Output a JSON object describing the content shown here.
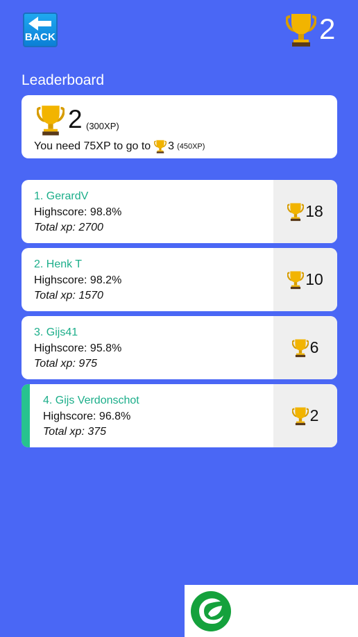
{
  "header": {
    "back_label": "BACK",
    "trophies": "2"
  },
  "section_title": "Leaderboard",
  "summary": {
    "level": "2",
    "xp": "(300XP)",
    "need_text": "You need 75XP to go to",
    "next_level": "3",
    "next_xp": "(450XP)"
  },
  "players": [
    {
      "name": "1. GerardV",
      "highscore": "Highscore: 98.8%",
      "total_xp": "Total xp: 2700",
      "trophies": "18"
    },
    {
      "name": "2. Henk T",
      "highscore": "Highscore: 98.2%",
      "total_xp": "Total xp: 1570",
      "trophies": "10"
    },
    {
      "name": "3. Gijs41",
      "highscore": "Highscore: 95.8%",
      "total_xp": "Total xp: 975",
      "trophies": "6"
    },
    {
      "name": "4. Gijs Verdonschot",
      "highscore": "Highscore: 96.8%",
      "total_xp": "Total xp: 375",
      "trophies": "2"
    }
  ],
  "colors": {
    "background": "#4a67f5",
    "accent": "#27c28f",
    "name": "#1cae8a",
    "trophy": "#f2b400"
  },
  "icons": {
    "back": "back-arrow-icon",
    "trophy": "trophy-icon",
    "logo": "leaf-logo"
  }
}
